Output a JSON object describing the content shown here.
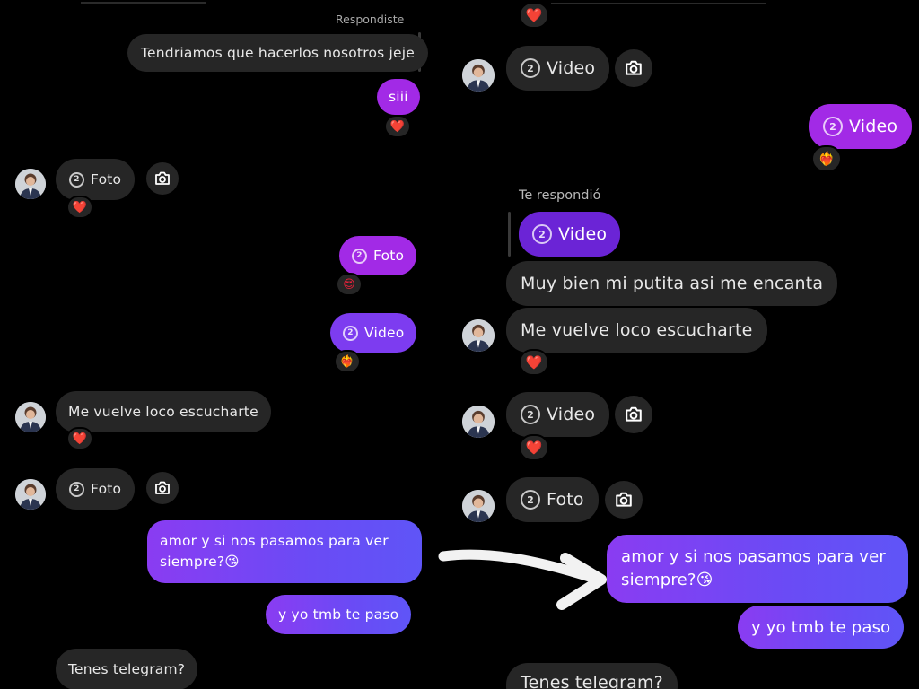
{
  "left": {
    "replied_label": "Respondiste",
    "msg_quoted": "Tendriamos que hacerlos nosotros jeje",
    "msg_siii": "siii",
    "foto_1": "Foto",
    "foto_2": "Foto",
    "video_1": "Video",
    "msg_loco": "Me vuelve loco escucharte",
    "foto_3": "Foto",
    "msg_amor_line1": "amor y si nos pasamos para ver",
    "msg_amor_line2": "siempre?😘",
    "msg_yo": "y yo tmb te paso",
    "msg_telegram": "Tenes telegram?"
  },
  "right": {
    "video_1": "Video",
    "video_2": "Video",
    "replied_label": "Te respondió",
    "video_reply": "Video",
    "msg_putita": "Muy bien mi putita asi me encanta",
    "msg_loco": "Me vuelve loco escucharte",
    "video_3": "Video",
    "foto_1": "Foto",
    "msg_amor_line1": "amor y si nos pasamos para ver",
    "msg_amor_line2": "siempre?😘",
    "msg_yo": "y yo tmb te paso",
    "msg_telegram": "Tenes telegram?"
  },
  "media_count_badge": "2",
  "reactions": {
    "heart": "❤️",
    "heart_eyes": "😍",
    "heart_on_fire": "❤️‍🔥"
  },
  "icons": [
    "camera-icon",
    "media-count-icon",
    "avatar",
    "arrow-annotation"
  ],
  "colors": {
    "background": "#000000",
    "received_bubble": "#262626",
    "sent_purple": "#7d3cf0",
    "sent_magenta": "#a22ae6",
    "sent_gradient_start": "#8a3cf2",
    "sent_gradient_end": "#5f55f7",
    "heart": "#e8213a",
    "annotation_arrow": "#ffffff"
  }
}
